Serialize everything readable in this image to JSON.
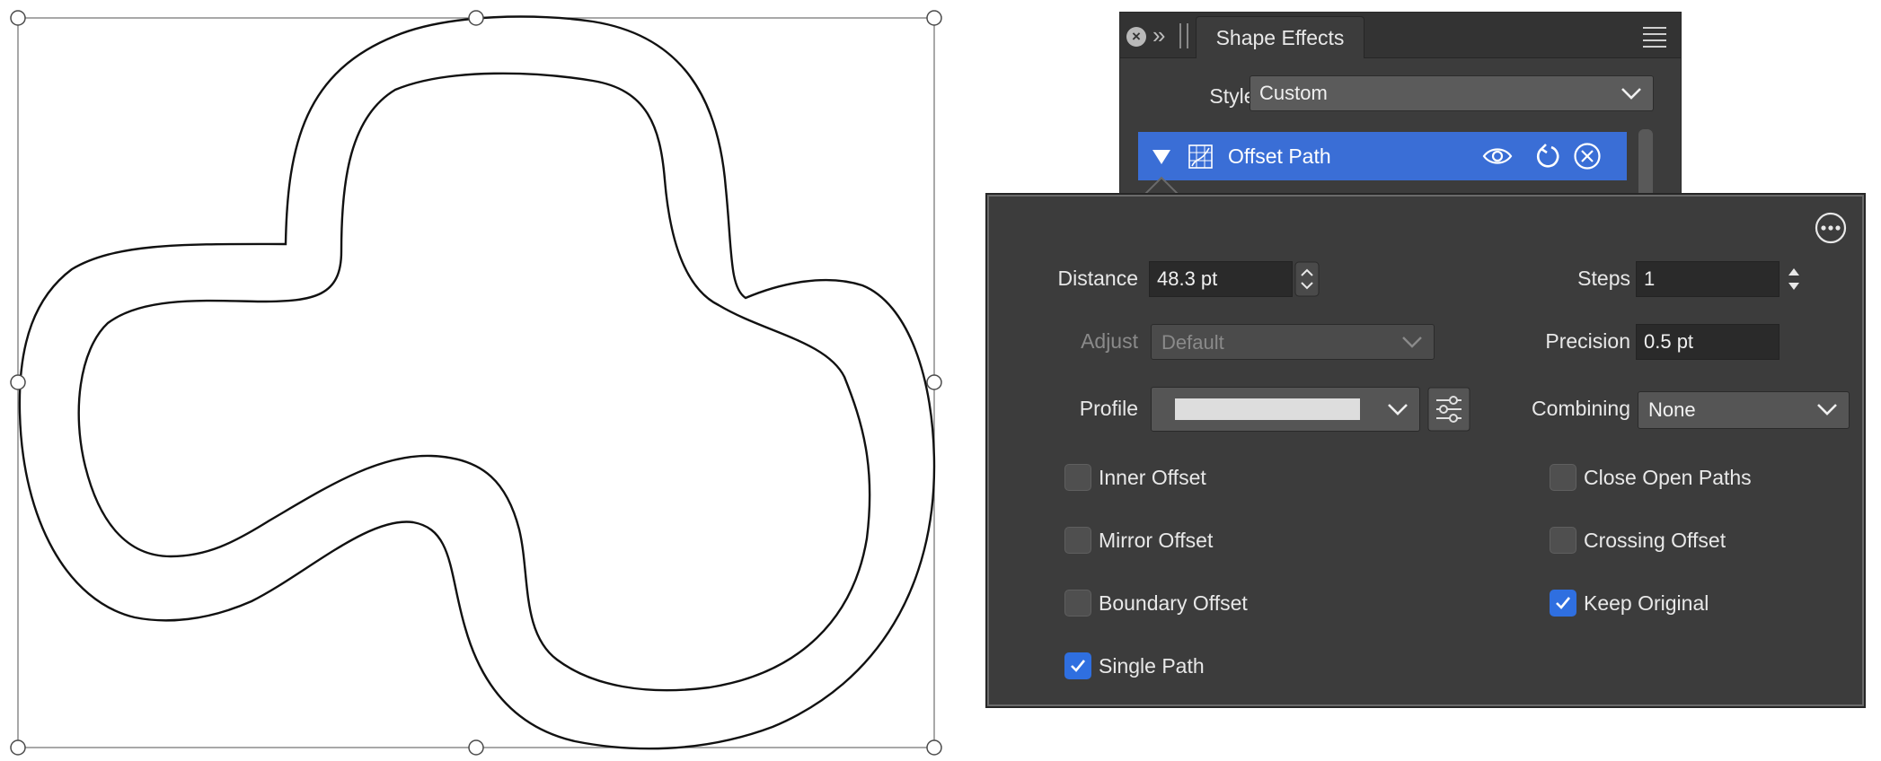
{
  "panel": {
    "tab_title": "Shape Effects",
    "styles_label": "Styles",
    "styles_value": "Custom",
    "effect_name": "Offset Path"
  },
  "effect": {
    "distance_label": "Distance",
    "distance_value": "48.3 pt",
    "steps_label": "Steps",
    "steps_value": "1",
    "adjust_label": "Adjust",
    "adjust_value": "Default",
    "precision_label": "Precision",
    "precision_value": "0.5 pt",
    "profile_label": "Profile",
    "combining_label": "Combining",
    "combining_value": "None",
    "checkboxes": [
      {
        "label": "Inner Offset",
        "checked": false
      },
      {
        "label": "Mirror Offset",
        "checked": false
      },
      {
        "label": "Boundary Offset",
        "checked": false
      },
      {
        "label": "Single Path",
        "checked": true
      },
      {
        "label": "Close Open Paths",
        "checked": false
      },
      {
        "label": "Crossing Offset",
        "checked": false
      },
      {
        "label": "Keep Original",
        "checked": true
      }
    ]
  },
  "colors": {
    "panel_bg": "#3c3c3c",
    "selected_row": "#3a6ed6",
    "checkbox_on": "#2f6fe0"
  }
}
